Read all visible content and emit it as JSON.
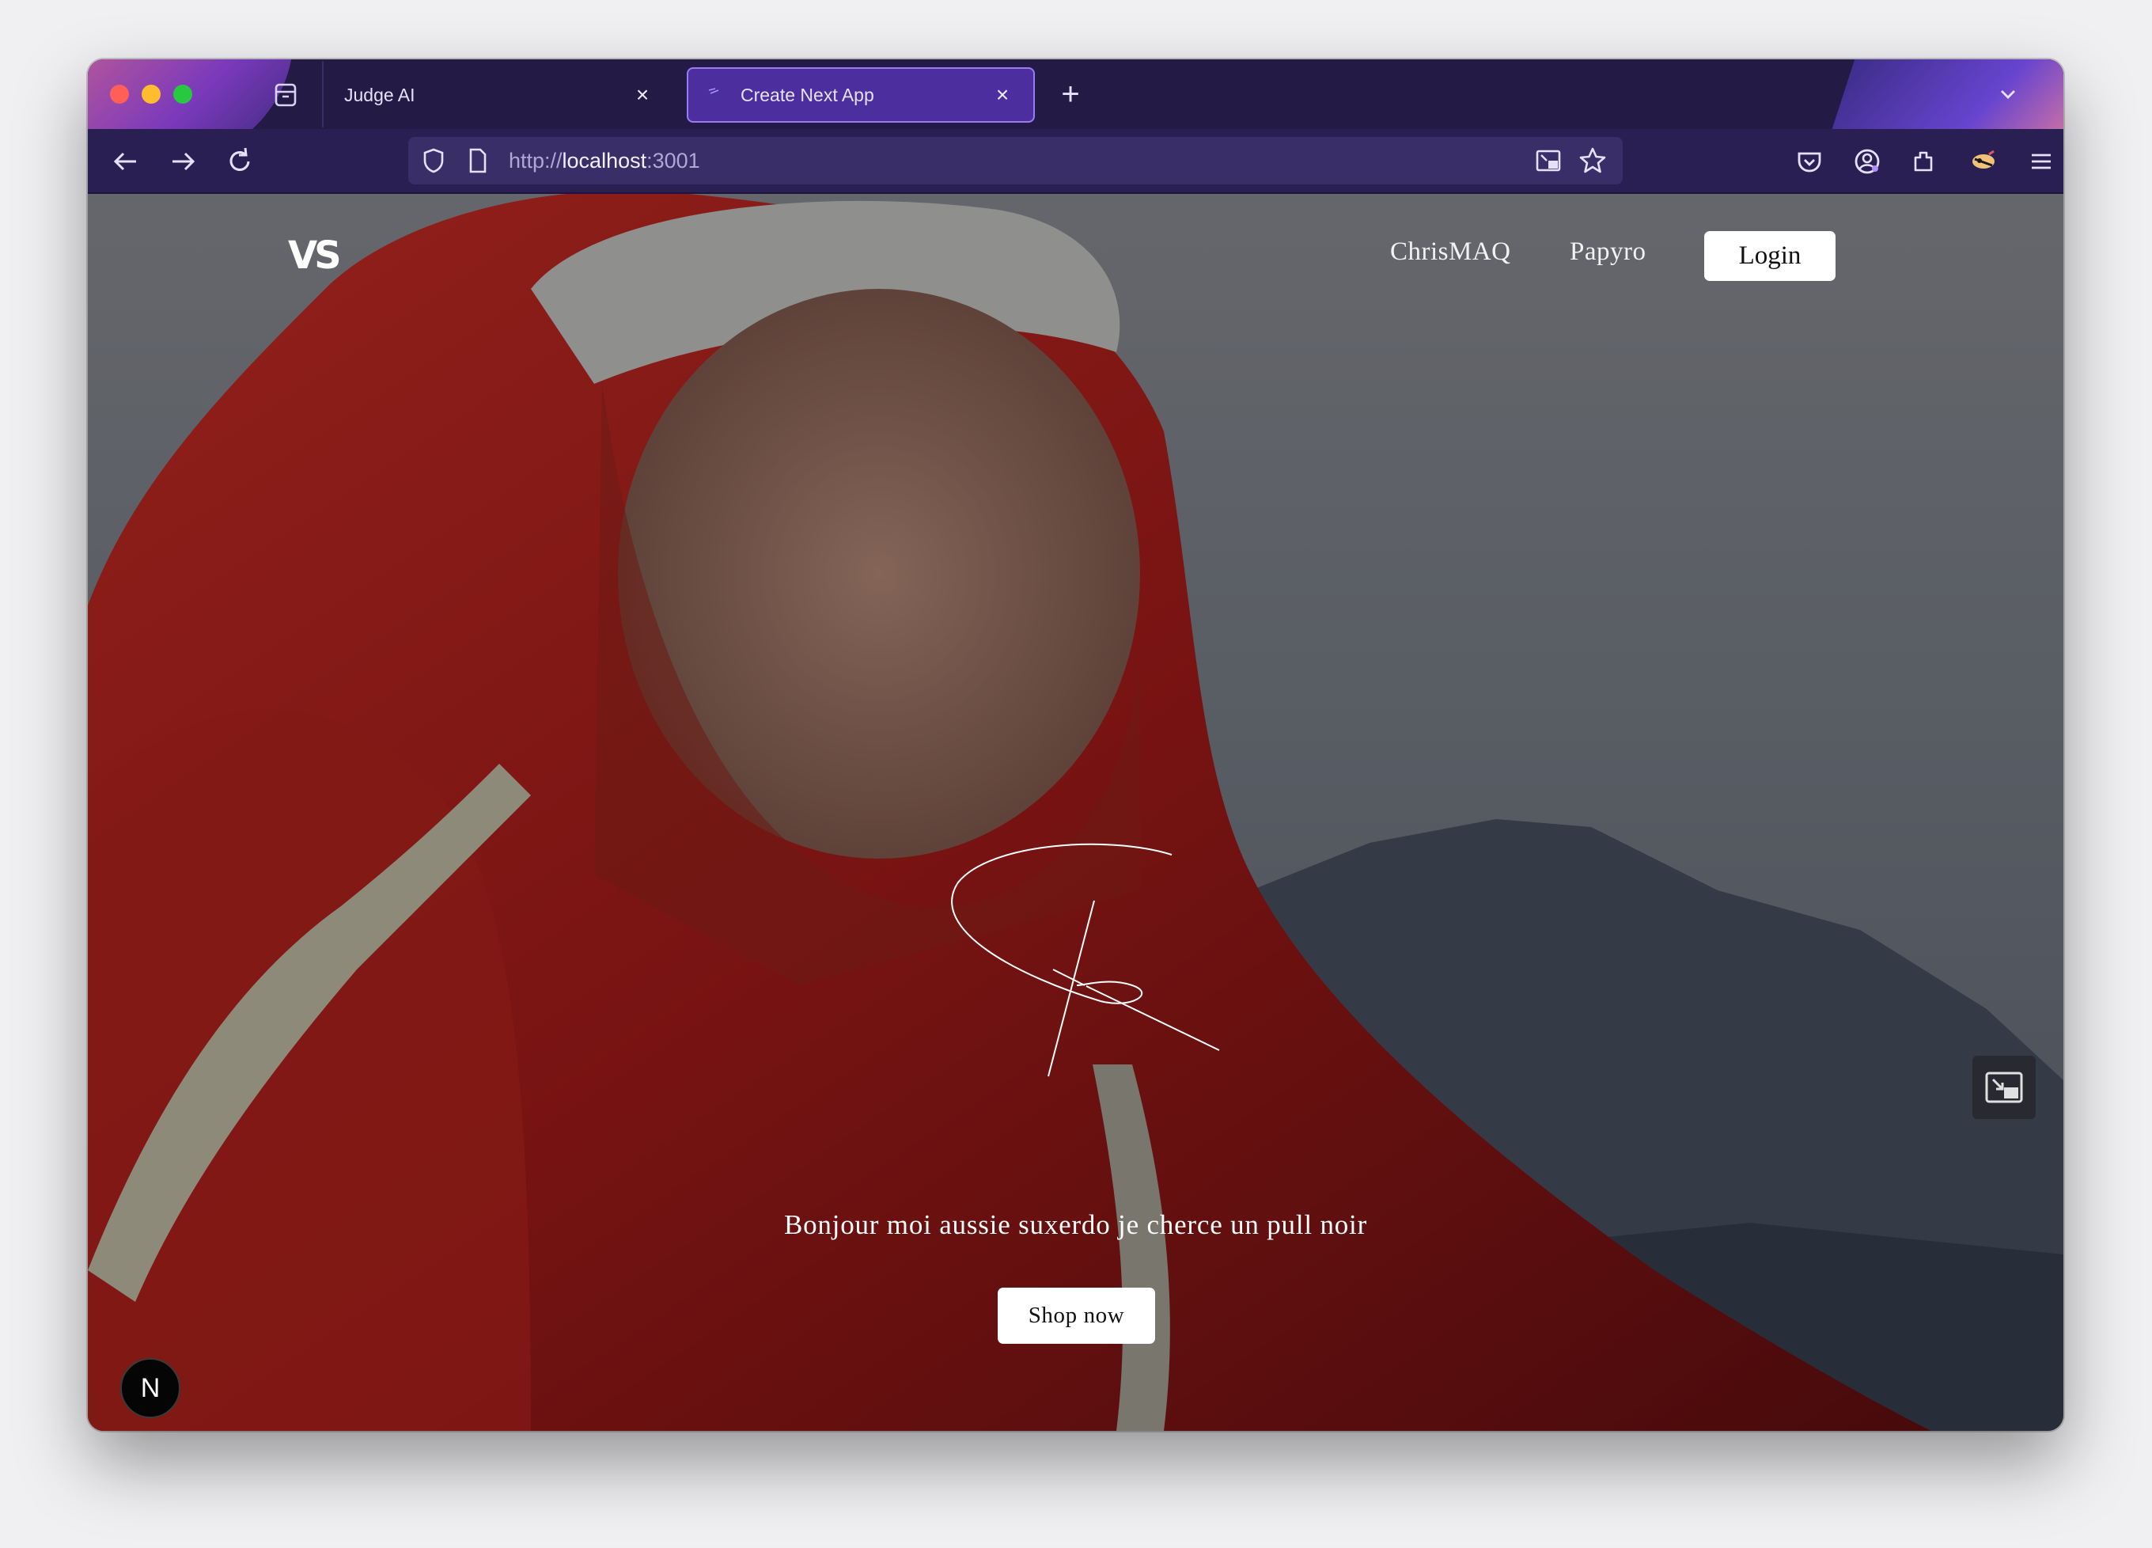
{
  "browser": {
    "tabs": [
      {
        "label": "Judge AI",
        "active": false
      },
      {
        "label": "Create Next App",
        "active": true
      }
    ],
    "url_scheme": "http://",
    "url_host": "localhost",
    "url_port": ":3001",
    "icons": {
      "tab_overview": "archive-icon",
      "new_tab": "plus-icon",
      "tab_list": "chevron-down-icon",
      "back": "arrow-left-icon",
      "forward": "arrow-right-icon",
      "reload": "reload-icon",
      "tracking": "shield-icon",
      "page": "page-icon",
      "pip": "picture-in-picture-icon",
      "bookmark": "star-icon",
      "pocket": "pocket-icon",
      "account": "account-icon",
      "extensions": "puzzle-icon",
      "extension_avatar": "extension-icon",
      "menu": "hamburger-icon"
    },
    "accent_color": "#4d2e9e"
  },
  "site": {
    "logo_text": "VS",
    "nav_links": [
      "ChrisMAQ",
      "Papyro"
    ],
    "login_label": "Login",
    "headline": "Bonjour moi aussie suxerdo je cherce un pull noir",
    "cta_label": "Shop now",
    "dev_badge": "N"
  }
}
